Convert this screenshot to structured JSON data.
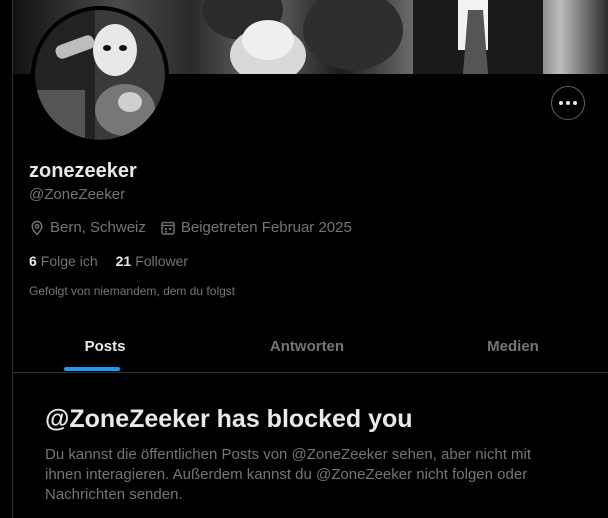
{
  "profile": {
    "display_name": "zonezeeker",
    "handle": "@ZoneZeeker",
    "location": "Bern, Schweiz",
    "joined": "Beigetreten Februar 2025",
    "following_count": "6",
    "following_label": "Folge ich",
    "followers_count": "21",
    "followers_label": "Follower",
    "followed_by": "Gefolgt von niemandem, dem du folgst"
  },
  "tabs": [
    {
      "label": "Posts",
      "active": true
    },
    {
      "label": "Antworten",
      "active": false
    },
    {
      "label": "Medien",
      "active": false
    }
  ],
  "blocked": {
    "title": "@ZoneZeeker has blocked you",
    "text": "Du kannst die öffentlichen Posts von @ZoneZeeker sehen, aber nicht mit ihnen interagieren. Außerdem kannst du @ZoneZeeker nicht folgen oder Nachrichten senden."
  },
  "colors": {
    "background": "#000000",
    "text_primary": "#e7e9ea",
    "text_secondary": "#71767b",
    "accent": "#1d9bf0",
    "border": "#2f3336"
  },
  "icons": [
    "location-pin-icon",
    "calendar-icon",
    "more-dots-icon"
  ]
}
